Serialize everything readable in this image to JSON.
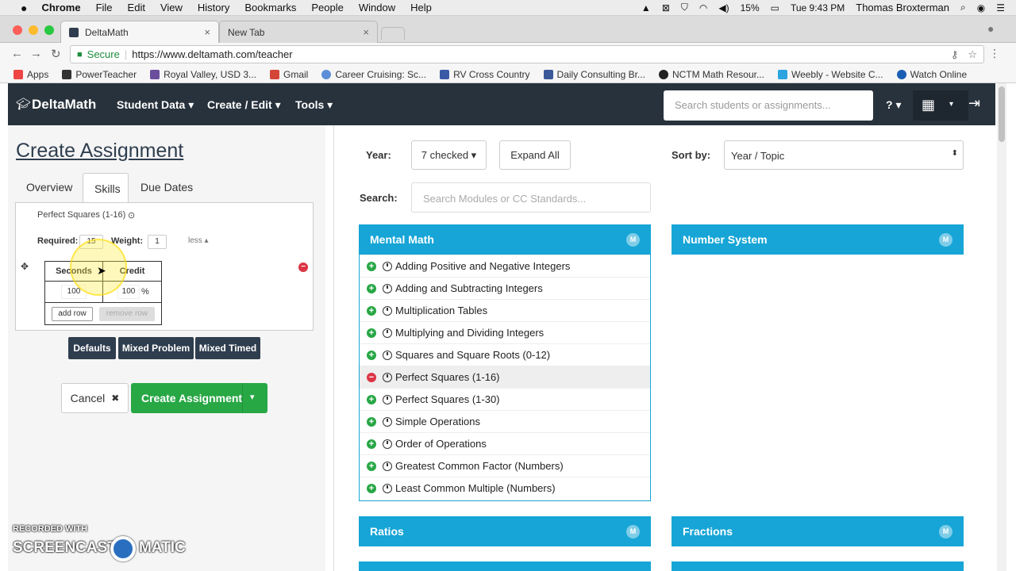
{
  "mac_menu": {
    "apple": "",
    "items": [
      "Chrome",
      "File",
      "Edit",
      "View",
      "History",
      "Bookmarks",
      "People",
      "Window",
      "Help"
    ],
    "battery": "15%",
    "clock": "Tue 9:43 PM",
    "user": "Thomas Broxterman"
  },
  "browser": {
    "tabs": [
      {
        "title": "DeltaMath",
        "close": "×"
      },
      {
        "title": "New Tab",
        "close": "×"
      }
    ],
    "secure_label": "Secure",
    "url": "https://www.deltamath.com/teacher",
    "bookmarks": [
      "Apps",
      "PowerTeacher",
      "Royal Valley, USD 3...",
      "Gmail",
      "Career Cruising: Sc...",
      "RV Cross Country",
      "Daily Consulting Br...",
      "NCTM Math Resour...",
      "Weebly - Website C...",
      "Watch Online"
    ]
  },
  "nav": {
    "logo": "DeltaMath",
    "items": [
      "Student Data ▾",
      "Create / Edit ▾",
      "Tools ▾"
    ],
    "search_placeholder": "Search students or assignments...",
    "help": "? ▾"
  },
  "left": {
    "title": "Create Assignment",
    "tabs": [
      "Overview",
      "Skills",
      "Due Dates"
    ],
    "skill_name": "Perfect Squares (1-16)",
    "required_label": "Required:",
    "required_value": "15",
    "weight_label": "Weight:",
    "weight_value": "1",
    "less_label": "less ▴",
    "table_headers": [
      "Seconds",
      "Credit"
    ],
    "seconds_value": "100",
    "credit_value": "100",
    "percent": "%",
    "add_row": "add row",
    "remove_row": "remove row",
    "buttons": [
      "Defaults",
      "Mixed Problem",
      "Mixed Timed"
    ],
    "cancel": "Cancel",
    "cancel_icon": "✖",
    "create": "Create Assignment",
    "create_caret": "▾"
  },
  "right": {
    "year_label": "Year:",
    "year_value": "7 checked ▾",
    "expand_all": "Expand All",
    "sort_label": "Sort by:",
    "sort_value": "Year / Topic",
    "search_label": "Search:",
    "search_placeholder": "Search Modules or CC Standards...",
    "modules": {
      "mental_math": "Mental Math",
      "number_system": "Number System",
      "ratios": "Ratios",
      "fractions": "Fractions",
      "badge": "M"
    },
    "skills": [
      {
        "name": "Adding Positive and Negative Integers",
        "selected": false
      },
      {
        "name": "Adding and Subtracting Integers",
        "selected": false
      },
      {
        "name": "Multiplication Tables",
        "selected": false
      },
      {
        "name": "Multiplying and Dividing Integers",
        "selected": false
      },
      {
        "name": "Squares and Square Roots (0-12)",
        "selected": false
      },
      {
        "name": "Perfect Squares (1-16)",
        "selected": true
      },
      {
        "name": "Perfect Squares (1-30)",
        "selected": false
      },
      {
        "name": "Simple Operations",
        "selected": false
      },
      {
        "name": "Order of Operations",
        "selected": false
      },
      {
        "name": "Greatest Common Factor (Numbers)",
        "selected": false
      },
      {
        "name": "Least Common Multiple (Numbers)",
        "selected": false
      }
    ]
  },
  "watermark": {
    "line1": "RECORDED WITH",
    "line2": "SCREENCAST",
    "line3": "MATIC"
  },
  "colors": {
    "nav_bg": "#28323c",
    "module_blue": "#16a5d6",
    "green": "#28a745",
    "dark_btn": "#2f3e4e"
  }
}
